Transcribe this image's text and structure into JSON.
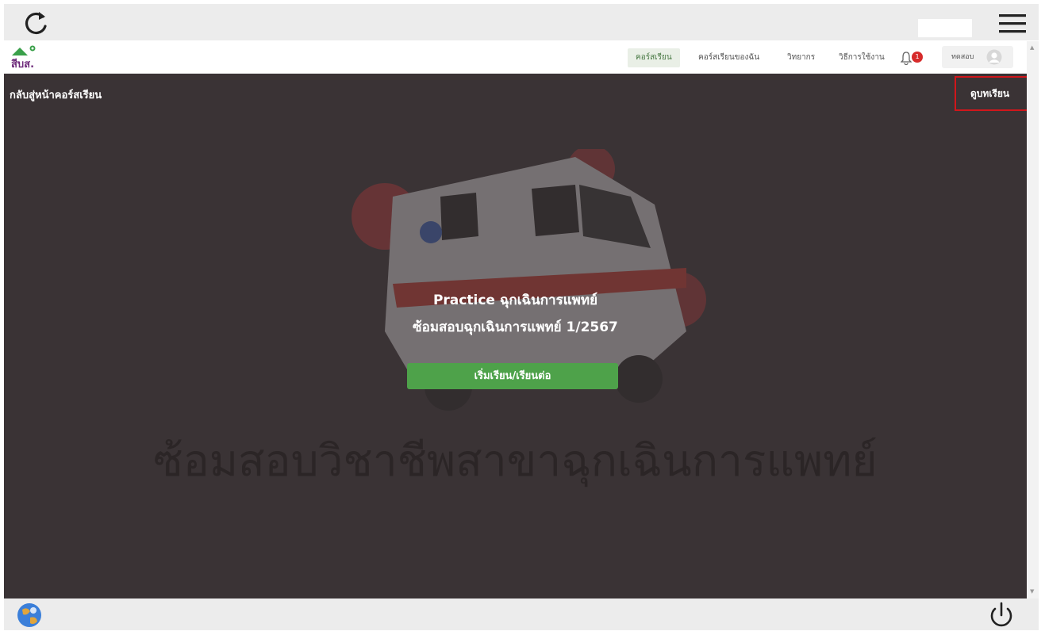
{
  "kiosk": {
    "refresh_icon": "refresh-icon",
    "menu_icon": "hamburger-menu-icon",
    "app_icon": "globe-app-icon",
    "power_icon": "power-icon"
  },
  "navbar": {
    "logo_text": "สีบส.",
    "items": [
      {
        "label": "คอร์สเรียน",
        "active": true
      },
      {
        "label": "คอร์สเรียนของฉัน",
        "active": false
      },
      {
        "label": "วิทยากร",
        "active": false
      },
      {
        "label": "วิธีการใช้งาน",
        "active": false
      }
    ],
    "notification_count": "1",
    "user_name": "ทดสอบ"
  },
  "hero": {
    "back_link": "กลับสู่หน้าคอร์สเรียน",
    "lesson_button": "ดูบทเรียน",
    "course_title": "Practice ฉุกเฉินการแพทย์",
    "course_subtitle": "ซ้อมสอบฉุกเฉินการแพทย์ 1/2567",
    "start_button": "เริ่มเรียน/เรียนต่อ",
    "watermark_text": "ซ้อมสอบวิชาชีพสาขาฉุกเฉินการแพทย์",
    "background_image": "ambulance-illustration"
  },
  "colors": {
    "hero_bg": "#3a3335",
    "start_button": "#4ea24a",
    "highlight_border": "#d0161b",
    "badge": "#d62b2b"
  }
}
